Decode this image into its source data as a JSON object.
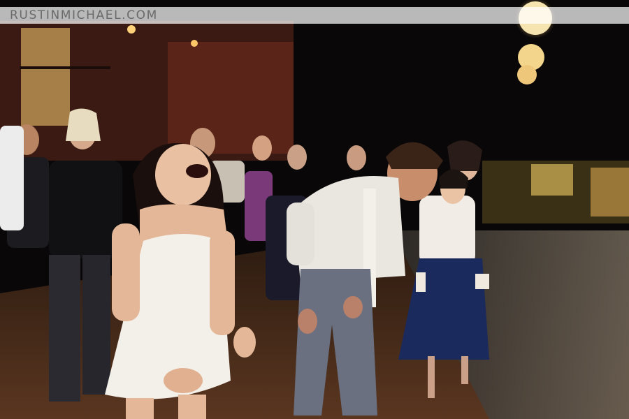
{
  "watermark": {
    "text": "RUSTINMICHAEL.COM"
  },
  "scene": {
    "description_icon": "wedding-dance-photo",
    "colors": {
      "night_sky": "#0a0a0c",
      "brick": "#5a2418",
      "floor": "#4a2c1c",
      "lantern": "#f4d58c",
      "dress_white": "#f3efe9",
      "navy_skirt": "#1b2a5c"
    }
  }
}
